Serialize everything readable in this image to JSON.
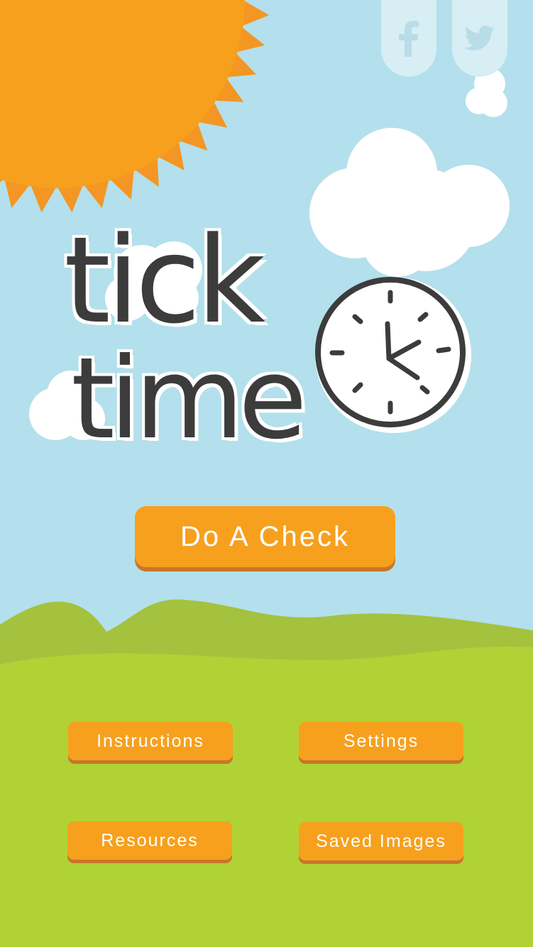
{
  "app": {
    "title": "Tick Time"
  },
  "logo": {
    "line1": "tick",
    "line2": "time"
  },
  "social": [
    {
      "name": "facebook",
      "icon": "facebook-icon"
    },
    {
      "name": "twitter",
      "icon": "twitter-icon"
    }
  ],
  "main_action": {
    "label": "Do A Check"
  },
  "menu": {
    "instructions": "Instructions",
    "settings": "Settings",
    "resources": "Resources",
    "saved_images": "Saved Images"
  },
  "colors": {
    "sky": "#b3e0ec",
    "sun": "#f6a01e",
    "button": "#f6a01e",
    "button_shadow": "#c9752a",
    "hill_back": "#a4c23e",
    "grass": "#b1d234",
    "cloud": "#ffffff",
    "ink": "#3c3c3c"
  }
}
